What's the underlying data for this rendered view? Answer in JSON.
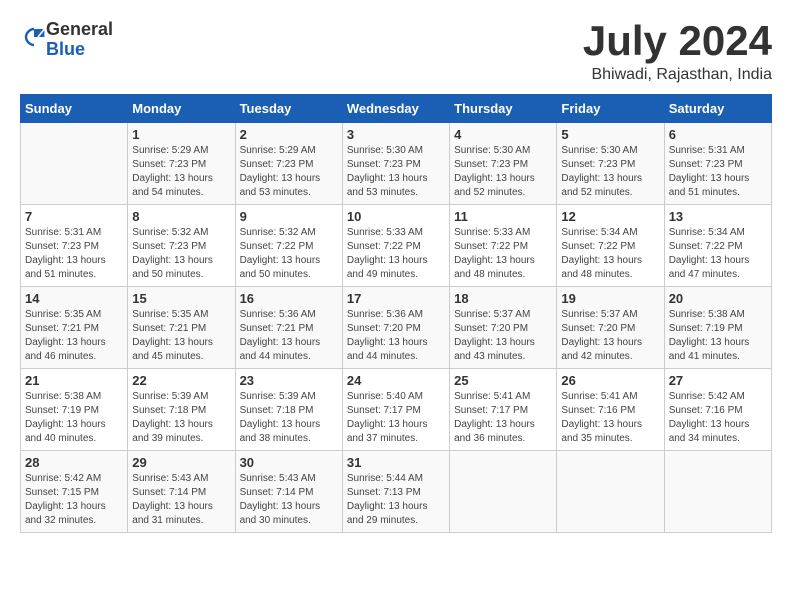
{
  "logo": {
    "general": "General",
    "blue": "Blue"
  },
  "title": "July 2024",
  "subtitle": "Bhiwadi, Rajasthan, India",
  "headers": [
    "Sunday",
    "Monday",
    "Tuesday",
    "Wednesday",
    "Thursday",
    "Friday",
    "Saturday"
  ],
  "weeks": [
    [
      {
        "day": "",
        "sunrise": "",
        "sunset": "",
        "daylight": ""
      },
      {
        "day": "1",
        "sunrise": "Sunrise: 5:29 AM",
        "sunset": "Sunset: 7:23 PM",
        "daylight": "Daylight: 13 hours and 54 minutes."
      },
      {
        "day": "2",
        "sunrise": "Sunrise: 5:29 AM",
        "sunset": "Sunset: 7:23 PM",
        "daylight": "Daylight: 13 hours and 53 minutes."
      },
      {
        "day": "3",
        "sunrise": "Sunrise: 5:30 AM",
        "sunset": "Sunset: 7:23 PM",
        "daylight": "Daylight: 13 hours and 53 minutes."
      },
      {
        "day": "4",
        "sunrise": "Sunrise: 5:30 AM",
        "sunset": "Sunset: 7:23 PM",
        "daylight": "Daylight: 13 hours and 52 minutes."
      },
      {
        "day": "5",
        "sunrise": "Sunrise: 5:30 AM",
        "sunset": "Sunset: 7:23 PM",
        "daylight": "Daylight: 13 hours and 52 minutes."
      },
      {
        "day": "6",
        "sunrise": "Sunrise: 5:31 AM",
        "sunset": "Sunset: 7:23 PM",
        "daylight": "Daylight: 13 hours and 51 minutes."
      }
    ],
    [
      {
        "day": "7",
        "sunrise": "Sunrise: 5:31 AM",
        "sunset": "Sunset: 7:23 PM",
        "daylight": "Daylight: 13 hours and 51 minutes."
      },
      {
        "day": "8",
        "sunrise": "Sunrise: 5:32 AM",
        "sunset": "Sunset: 7:23 PM",
        "daylight": "Daylight: 13 hours and 50 minutes."
      },
      {
        "day": "9",
        "sunrise": "Sunrise: 5:32 AM",
        "sunset": "Sunset: 7:22 PM",
        "daylight": "Daylight: 13 hours and 50 minutes."
      },
      {
        "day": "10",
        "sunrise": "Sunrise: 5:33 AM",
        "sunset": "Sunset: 7:22 PM",
        "daylight": "Daylight: 13 hours and 49 minutes."
      },
      {
        "day": "11",
        "sunrise": "Sunrise: 5:33 AM",
        "sunset": "Sunset: 7:22 PM",
        "daylight": "Daylight: 13 hours and 48 minutes."
      },
      {
        "day": "12",
        "sunrise": "Sunrise: 5:34 AM",
        "sunset": "Sunset: 7:22 PM",
        "daylight": "Daylight: 13 hours and 48 minutes."
      },
      {
        "day": "13",
        "sunrise": "Sunrise: 5:34 AM",
        "sunset": "Sunset: 7:22 PM",
        "daylight": "Daylight: 13 hours and 47 minutes."
      }
    ],
    [
      {
        "day": "14",
        "sunrise": "Sunrise: 5:35 AM",
        "sunset": "Sunset: 7:21 PM",
        "daylight": "Daylight: 13 hours and 46 minutes."
      },
      {
        "day": "15",
        "sunrise": "Sunrise: 5:35 AM",
        "sunset": "Sunset: 7:21 PM",
        "daylight": "Daylight: 13 hours and 45 minutes."
      },
      {
        "day": "16",
        "sunrise": "Sunrise: 5:36 AM",
        "sunset": "Sunset: 7:21 PM",
        "daylight": "Daylight: 13 hours and 44 minutes."
      },
      {
        "day": "17",
        "sunrise": "Sunrise: 5:36 AM",
        "sunset": "Sunset: 7:20 PM",
        "daylight": "Daylight: 13 hours and 44 minutes."
      },
      {
        "day": "18",
        "sunrise": "Sunrise: 5:37 AM",
        "sunset": "Sunset: 7:20 PM",
        "daylight": "Daylight: 13 hours and 43 minutes."
      },
      {
        "day": "19",
        "sunrise": "Sunrise: 5:37 AM",
        "sunset": "Sunset: 7:20 PM",
        "daylight": "Daylight: 13 hours and 42 minutes."
      },
      {
        "day": "20",
        "sunrise": "Sunrise: 5:38 AM",
        "sunset": "Sunset: 7:19 PM",
        "daylight": "Daylight: 13 hours and 41 minutes."
      }
    ],
    [
      {
        "day": "21",
        "sunrise": "Sunrise: 5:38 AM",
        "sunset": "Sunset: 7:19 PM",
        "daylight": "Daylight: 13 hours and 40 minutes."
      },
      {
        "day": "22",
        "sunrise": "Sunrise: 5:39 AM",
        "sunset": "Sunset: 7:18 PM",
        "daylight": "Daylight: 13 hours and 39 minutes."
      },
      {
        "day": "23",
        "sunrise": "Sunrise: 5:39 AM",
        "sunset": "Sunset: 7:18 PM",
        "daylight": "Daylight: 13 hours and 38 minutes."
      },
      {
        "day": "24",
        "sunrise": "Sunrise: 5:40 AM",
        "sunset": "Sunset: 7:17 PM",
        "daylight": "Daylight: 13 hours and 37 minutes."
      },
      {
        "day": "25",
        "sunrise": "Sunrise: 5:41 AM",
        "sunset": "Sunset: 7:17 PM",
        "daylight": "Daylight: 13 hours and 36 minutes."
      },
      {
        "day": "26",
        "sunrise": "Sunrise: 5:41 AM",
        "sunset": "Sunset: 7:16 PM",
        "daylight": "Daylight: 13 hours and 35 minutes."
      },
      {
        "day": "27",
        "sunrise": "Sunrise: 5:42 AM",
        "sunset": "Sunset: 7:16 PM",
        "daylight": "Daylight: 13 hours and 34 minutes."
      }
    ],
    [
      {
        "day": "28",
        "sunrise": "Sunrise: 5:42 AM",
        "sunset": "Sunset: 7:15 PM",
        "daylight": "Daylight: 13 hours and 32 minutes."
      },
      {
        "day": "29",
        "sunrise": "Sunrise: 5:43 AM",
        "sunset": "Sunset: 7:14 PM",
        "daylight": "Daylight: 13 hours and 31 minutes."
      },
      {
        "day": "30",
        "sunrise": "Sunrise: 5:43 AM",
        "sunset": "Sunset: 7:14 PM",
        "daylight": "Daylight: 13 hours and 30 minutes."
      },
      {
        "day": "31",
        "sunrise": "Sunrise: 5:44 AM",
        "sunset": "Sunset: 7:13 PM",
        "daylight": "Daylight: 13 hours and 29 minutes."
      },
      {
        "day": "",
        "sunrise": "",
        "sunset": "",
        "daylight": ""
      },
      {
        "day": "",
        "sunrise": "",
        "sunset": "",
        "daylight": ""
      },
      {
        "day": "",
        "sunrise": "",
        "sunset": "",
        "daylight": ""
      }
    ]
  ]
}
